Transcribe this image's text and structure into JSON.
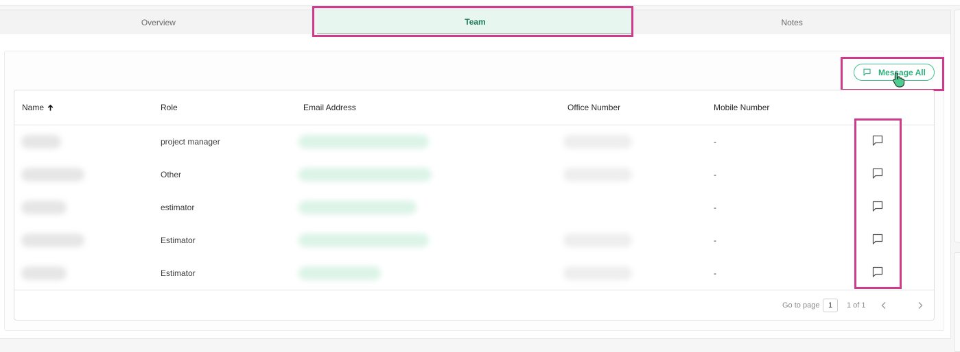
{
  "tabs": [
    {
      "label": "Overview",
      "active": false
    },
    {
      "label": "Team",
      "active": true
    },
    {
      "label": "Notes",
      "active": false
    }
  ],
  "toolbar": {
    "message_all_label": "Message All",
    "icon": "chat-bubble-icon"
  },
  "table": {
    "columns": {
      "name": "Name",
      "role": "Role",
      "email": "Email Address",
      "office": "Office Number",
      "mobile": "Mobile Number"
    },
    "sort": {
      "column": "Name",
      "direction": "ascending",
      "icon": "arrow-up-icon"
    },
    "rows": [
      {
        "role": "project manager",
        "mobile": "-"
      },
      {
        "role": "Other",
        "mobile": "-"
      },
      {
        "role": "estimator",
        "mobile": "-"
      },
      {
        "role": "Estimator",
        "mobile": "-"
      },
      {
        "role": "Estimator",
        "mobile": "-"
      }
    ]
  },
  "pagination": {
    "go_to_label": "Go to page",
    "current_page": "1",
    "page_count_label": "1 of 1"
  },
  "colors": {
    "accent": "#2fb07d",
    "active_tab_bg": "#e7f7ef",
    "highlight": "#cf3a8a"
  }
}
